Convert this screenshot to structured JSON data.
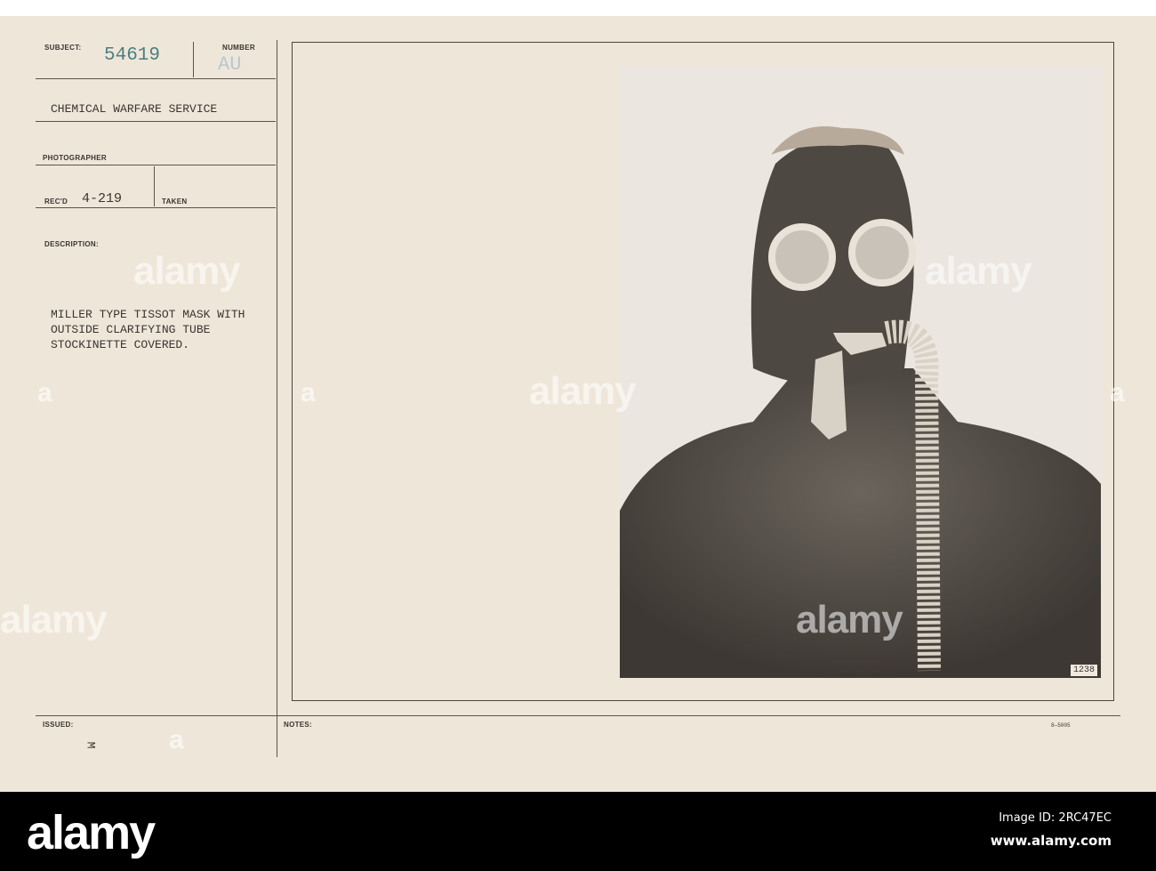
{
  "card": {
    "subject_label": "SUBJECT:",
    "subject_value": "54619",
    "number_label": "NUMBER",
    "number_value": "AU",
    "title": "CHEMICAL WARFARE SERVICE",
    "photographer_label": "PHOTOGRAPHER",
    "recd_label": "REC'D",
    "recd_value": "4-219",
    "taken_label": "TAKEN",
    "description_label": "DESCRIPTION:",
    "description_lines": [
      "MILLER TYPE TISSOT MASK WITH",
      "OUTSIDE CLARIFYING TUBE",
      "STOCKINETTE COVERED."
    ],
    "issued_label": "ISSUED:",
    "issued_value": "M",
    "notes_label": "NOTES:",
    "photo_number": "1238",
    "form_number": "8—5005"
  },
  "watermark": {
    "text": "alamy",
    "letter": "a"
  },
  "footer": {
    "logo": "alamy",
    "image_id": "Image ID: 2RC47EC",
    "url": "www.alamy.com"
  }
}
